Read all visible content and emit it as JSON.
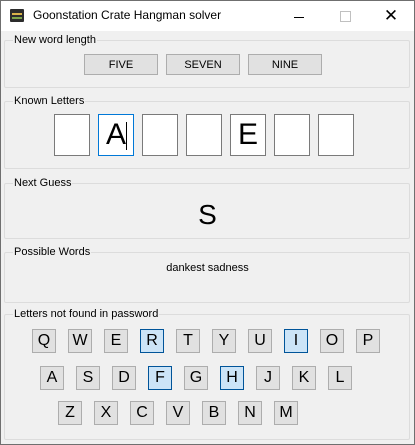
{
  "window": {
    "title": "Goonstation Crate Hangman solver",
    "close_glyph": "✕"
  },
  "length_group": {
    "label": "New word length",
    "buttons": [
      "FIVE",
      "SEVEN",
      "NINE"
    ]
  },
  "known_group": {
    "label": "Known Letters",
    "letters": [
      "",
      "A",
      "",
      "",
      "E",
      "",
      ""
    ]
  },
  "guess_group": {
    "label": "Next Guess",
    "value": "S"
  },
  "words_group": {
    "label": "Possible Words",
    "value": "dankest sadness"
  },
  "letters_group": {
    "label": "Letters not found in password",
    "row1": [
      {
        "letter": "Q",
        "active": false
      },
      {
        "letter": "W",
        "active": false
      },
      {
        "letter": "E",
        "active": false
      },
      {
        "letter": "R",
        "active": true
      },
      {
        "letter": "T",
        "active": false
      },
      {
        "letter": "Y",
        "active": false
      },
      {
        "letter": "U",
        "active": false
      },
      {
        "letter": "I",
        "active": true
      },
      {
        "letter": "O",
        "active": false
      },
      {
        "letter": "P",
        "active": false
      }
    ],
    "row2": [
      {
        "letter": "A",
        "active": false
      },
      {
        "letter": "S",
        "active": false
      },
      {
        "letter": "D",
        "active": false
      },
      {
        "letter": "F",
        "active": true
      },
      {
        "letter": "G",
        "active": false
      },
      {
        "letter": "H",
        "active": true
      },
      {
        "letter": "J",
        "active": false
      },
      {
        "letter": "K",
        "active": false
      },
      {
        "letter": "L",
        "active": false
      }
    ],
    "row3": [
      {
        "letter": "Z",
        "active": false
      },
      {
        "letter": "X",
        "active": false
      },
      {
        "letter": "C",
        "active": false
      },
      {
        "letter": "V",
        "active": false
      },
      {
        "letter": "B",
        "active": false
      },
      {
        "letter": "N",
        "active": false
      },
      {
        "letter": "M",
        "active": false
      }
    ]
  },
  "colors": {
    "active_key_bg": "#cce4f7",
    "active_key_border": "#005499",
    "focus_border": "#0078d7"
  }
}
